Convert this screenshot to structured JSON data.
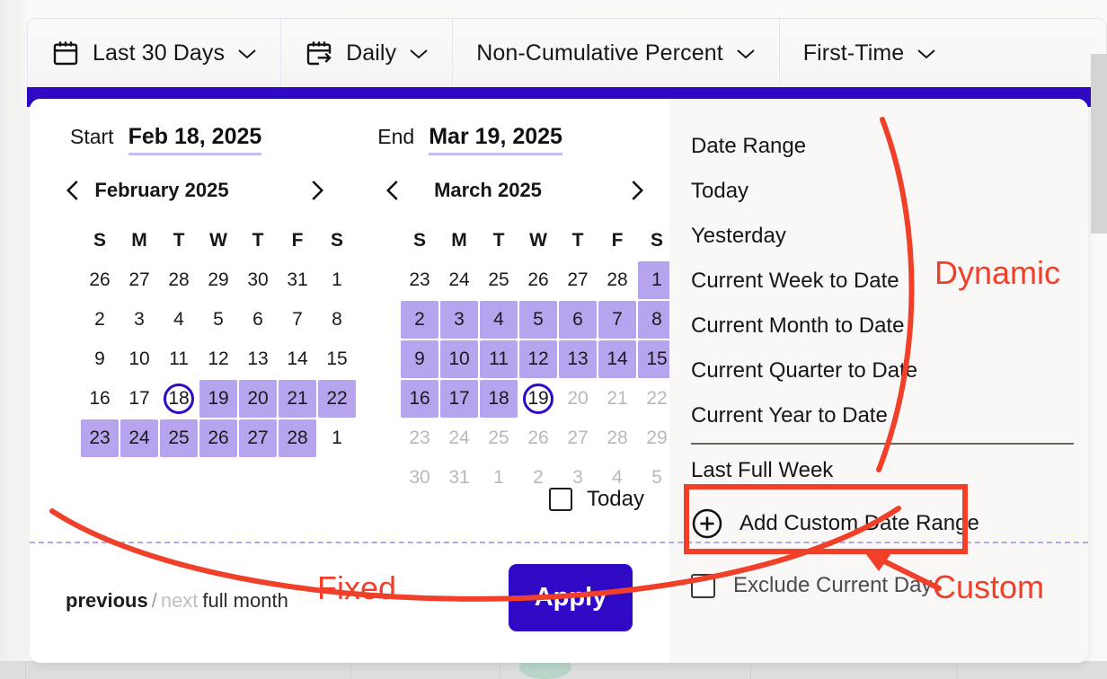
{
  "toolbar": {
    "items": [
      {
        "label": "Last 30 Days",
        "icon": "calendar-icon"
      },
      {
        "label": "Daily",
        "icon": "calendar-arrow-icon"
      },
      {
        "label": "Non-Cumulative Percent",
        "icon": "none"
      },
      {
        "label": "First-Time",
        "icon": "none"
      }
    ]
  },
  "range": {
    "start_label": "Start",
    "start_value": "Feb 18, 2025",
    "end_label": "End",
    "end_value": "Mar 19, 2025"
  },
  "calendars": [
    {
      "title": "February 2025",
      "dow": [
        "S",
        "M",
        "T",
        "W",
        "T",
        "F",
        "S"
      ],
      "weeks": [
        [
          {
            "d": "26",
            "state": "plain"
          },
          {
            "d": "27",
            "state": "plain"
          },
          {
            "d": "28",
            "state": "plain"
          },
          {
            "d": "29",
            "state": "plain"
          },
          {
            "d": "30",
            "state": "plain"
          },
          {
            "d": "31",
            "state": "plain"
          },
          {
            "d": "1",
            "state": "plain"
          }
        ],
        [
          {
            "d": "2",
            "state": "plain"
          },
          {
            "d": "3",
            "state": "plain"
          },
          {
            "d": "4",
            "state": "plain"
          },
          {
            "d": "5",
            "state": "plain"
          },
          {
            "d": "6",
            "state": "plain"
          },
          {
            "d": "7",
            "state": "plain"
          },
          {
            "d": "8",
            "state": "plain"
          }
        ],
        [
          {
            "d": "9",
            "state": "plain"
          },
          {
            "d": "10",
            "state": "plain"
          },
          {
            "d": "11",
            "state": "plain"
          },
          {
            "d": "12",
            "state": "plain"
          },
          {
            "d": "13",
            "state": "plain"
          },
          {
            "d": "14",
            "state": "plain"
          },
          {
            "d": "15",
            "state": "plain"
          }
        ],
        [
          {
            "d": "16",
            "state": "plain"
          },
          {
            "d": "17",
            "state": "plain"
          },
          {
            "d": "18",
            "state": "edge"
          },
          {
            "d": "19",
            "state": "selected"
          },
          {
            "d": "20",
            "state": "selected"
          },
          {
            "d": "21",
            "state": "selected"
          },
          {
            "d": "22",
            "state": "selected"
          }
        ],
        [
          {
            "d": "23",
            "state": "selected"
          },
          {
            "d": "24",
            "state": "selected"
          },
          {
            "d": "25",
            "state": "selected"
          },
          {
            "d": "26",
            "state": "selected"
          },
          {
            "d": "27",
            "state": "selected"
          },
          {
            "d": "28",
            "state": "selected"
          },
          {
            "d": "1",
            "state": "plain"
          }
        ]
      ]
    },
    {
      "title": "March 2025",
      "dow": [
        "S",
        "M",
        "T",
        "W",
        "T",
        "F",
        "S"
      ],
      "weeks": [
        [
          {
            "d": "23",
            "state": "plain"
          },
          {
            "d": "24",
            "state": "plain"
          },
          {
            "d": "25",
            "state": "plain"
          },
          {
            "d": "26",
            "state": "plain"
          },
          {
            "d": "27",
            "state": "plain"
          },
          {
            "d": "28",
            "state": "plain"
          },
          {
            "d": "1",
            "state": "selected"
          }
        ],
        [
          {
            "d": "2",
            "state": "selected"
          },
          {
            "d": "3",
            "state": "selected"
          },
          {
            "d": "4",
            "state": "selected"
          },
          {
            "d": "5",
            "state": "selected"
          },
          {
            "d": "6",
            "state": "selected"
          },
          {
            "d": "7",
            "state": "selected"
          },
          {
            "d": "8",
            "state": "selected"
          }
        ],
        [
          {
            "d": "9",
            "state": "selected"
          },
          {
            "d": "10",
            "state": "selected"
          },
          {
            "d": "11",
            "state": "selected"
          },
          {
            "d": "12",
            "state": "selected"
          },
          {
            "d": "13",
            "state": "selected"
          },
          {
            "d": "14",
            "state": "selected"
          },
          {
            "d": "15",
            "state": "selected"
          }
        ],
        [
          {
            "d": "16",
            "state": "selected"
          },
          {
            "d": "17",
            "state": "selected"
          },
          {
            "d": "18",
            "state": "selected"
          },
          {
            "d": "19",
            "state": "edge"
          },
          {
            "d": "20",
            "state": "muted"
          },
          {
            "d": "21",
            "state": "muted"
          },
          {
            "d": "22",
            "state": "muted"
          }
        ],
        [
          {
            "d": "23",
            "state": "muted"
          },
          {
            "d": "24",
            "state": "muted"
          },
          {
            "d": "25",
            "state": "muted"
          },
          {
            "d": "26",
            "state": "muted"
          },
          {
            "d": "27",
            "state": "muted"
          },
          {
            "d": "28",
            "state": "muted"
          },
          {
            "d": "29",
            "state": "muted"
          }
        ],
        [
          {
            "d": "30",
            "state": "muted"
          },
          {
            "d": "31",
            "state": "muted"
          },
          {
            "d": "1",
            "state": "muted"
          },
          {
            "d": "2",
            "state": "muted"
          },
          {
            "d": "3",
            "state": "muted"
          },
          {
            "d": "4",
            "state": "muted"
          },
          {
            "d": "5",
            "state": "muted"
          }
        ]
      ]
    }
  ],
  "today_checkbox": {
    "label": "Today",
    "checked": false
  },
  "footer": {
    "previous": "previous",
    "separator": "/",
    "next": "next",
    "full_month": "full month",
    "apply_label": "Apply"
  },
  "presets": {
    "dynamic": [
      "Date Range",
      "Today",
      "Yesterday",
      "Current Week to Date",
      "Current Month to Date",
      "Current Quarter to Date",
      "Current Year to Date"
    ],
    "fixed": [
      "Last Full Week"
    ],
    "add_custom_label": "Add Custom Date Range",
    "add_custom_icon": "plus-circle-icon",
    "exclude": {
      "label": "Exclude Current Day",
      "checked": false
    }
  },
  "annotations": [
    {
      "id": "dynamic",
      "text": "Dynamic"
    },
    {
      "id": "fixed",
      "text": "Fixed"
    },
    {
      "id": "custom",
      "text": "Custom"
    }
  ],
  "colors": {
    "accent_blue": "#3009c4",
    "range_highlight": "#b7a4ef",
    "annotation_red": "#f0402a",
    "underline_purple": "#c8bbf0",
    "dashed_purple": "#b4a6ea"
  }
}
